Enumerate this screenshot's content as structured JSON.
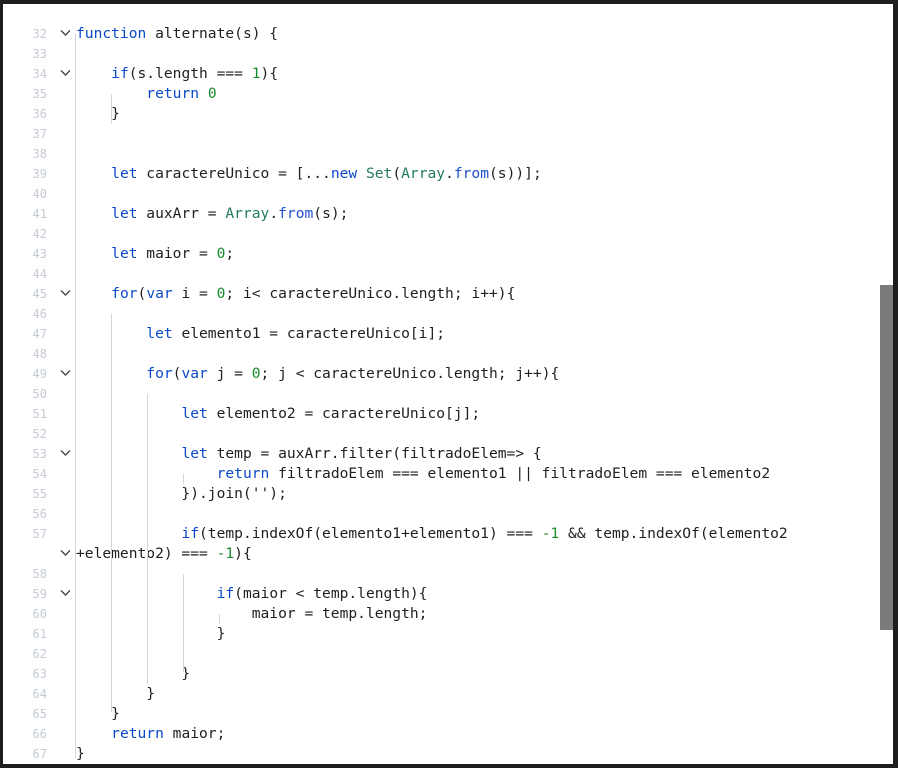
{
  "editor": {
    "language": "javascript",
    "colors": {
      "keyword": "#0b49c9",
      "builtin": "#237a5e",
      "number": "#188a2b",
      "text": "#1f1f1f"
    },
    "lines": [
      {
        "n": "32",
        "fold": true,
        "code": [
          {
            "t": "function",
            "c": "kw"
          },
          {
            "t": " alternate(s) {"
          }
        ]
      },
      {
        "n": "33",
        "fold": false,
        "code": []
      },
      {
        "n": "34",
        "fold": true,
        "code": [
          {
            "t": "    "
          },
          {
            "t": "if",
            "c": "kw"
          },
          {
            "t": "(s.length === "
          },
          {
            "t": "1",
            "c": "num"
          },
          {
            "t": "){"
          }
        ]
      },
      {
        "n": "35",
        "fold": false,
        "code": [
          {
            "t": "        "
          },
          {
            "t": "return",
            "c": "kw"
          },
          {
            "t": " "
          },
          {
            "t": "0",
            "c": "num"
          }
        ]
      },
      {
        "n": "36",
        "fold": false,
        "code": [
          {
            "t": "    }"
          }
        ]
      },
      {
        "n": "37",
        "fold": false,
        "code": []
      },
      {
        "n": "38",
        "fold": false,
        "code": []
      },
      {
        "n": "39",
        "fold": false,
        "code": [
          {
            "t": "    "
          },
          {
            "t": "let",
            "c": "kw"
          },
          {
            "t": " caractereUnico = [..."
          },
          {
            "t": "new",
            "c": "kw"
          },
          {
            "t": " "
          },
          {
            "t": "Set",
            "c": "cls"
          },
          {
            "t": "("
          },
          {
            "t": "Array",
            "c": "cls"
          },
          {
            "t": "."
          },
          {
            "t": "from",
            "c": "fn"
          },
          {
            "t": "(s))];"
          }
        ]
      },
      {
        "n": "40",
        "fold": false,
        "code": []
      },
      {
        "n": "41",
        "fold": false,
        "code": [
          {
            "t": "    "
          },
          {
            "t": "let",
            "c": "kw"
          },
          {
            "t": " auxArr = "
          },
          {
            "t": "Array",
            "c": "cls"
          },
          {
            "t": "."
          },
          {
            "t": "from",
            "c": "fn"
          },
          {
            "t": "(s);"
          }
        ]
      },
      {
        "n": "42",
        "fold": false,
        "code": []
      },
      {
        "n": "43",
        "fold": false,
        "code": [
          {
            "t": "    "
          },
          {
            "t": "let",
            "c": "kw"
          },
          {
            "t": " maior = "
          },
          {
            "t": "0",
            "c": "num"
          },
          {
            "t": ";"
          }
        ]
      },
      {
        "n": "44",
        "fold": false,
        "code": []
      },
      {
        "n": "45",
        "fold": true,
        "code": [
          {
            "t": "    "
          },
          {
            "t": "for",
            "c": "kw"
          },
          {
            "t": "("
          },
          {
            "t": "var",
            "c": "kw"
          },
          {
            "t": " i = "
          },
          {
            "t": "0",
            "c": "num"
          },
          {
            "t": "; i< caractereUnico.length; i++){"
          }
        ]
      },
      {
        "n": "46",
        "fold": false,
        "code": []
      },
      {
        "n": "47",
        "fold": false,
        "code": [
          {
            "t": "        "
          },
          {
            "t": "let",
            "c": "kw"
          },
          {
            "t": " elemento1 = caractereUnico[i];"
          }
        ]
      },
      {
        "n": "48",
        "fold": false,
        "code": []
      },
      {
        "n": "49",
        "fold": true,
        "code": [
          {
            "t": "        "
          },
          {
            "t": "for",
            "c": "kw"
          },
          {
            "t": "("
          },
          {
            "t": "var",
            "c": "kw"
          },
          {
            "t": " j = "
          },
          {
            "t": "0",
            "c": "num"
          },
          {
            "t": "; j < caractereUnico.length; j++){"
          }
        ]
      },
      {
        "n": "50",
        "fold": false,
        "code": []
      },
      {
        "n": "51",
        "fold": false,
        "code": [
          {
            "t": "            "
          },
          {
            "t": "let",
            "c": "kw"
          },
          {
            "t": " elemento2 = caractereUnico[j];"
          }
        ]
      },
      {
        "n": "52",
        "fold": false,
        "code": []
      },
      {
        "n": "53",
        "fold": true,
        "code": [
          {
            "t": "            "
          },
          {
            "t": "let",
            "c": "kw"
          },
          {
            "t": " temp = auxArr.filter(filtradoElem=> {"
          }
        ]
      },
      {
        "n": "54",
        "fold": false,
        "code": [
          {
            "t": "                "
          },
          {
            "t": "return",
            "c": "kw"
          },
          {
            "t": " filtradoElem === elemento1 || filtradoElem === elemento2"
          }
        ]
      },
      {
        "n": "55",
        "fold": false,
        "code": [
          {
            "t": "            }).join('');"
          }
        ]
      },
      {
        "n": "56",
        "fold": false,
        "code": []
      },
      {
        "n": "57",
        "fold": false,
        "code": [
          {
            "t": "            "
          },
          {
            "t": "if",
            "c": "kw"
          },
          {
            "t": "(temp.indexOf(elemento1+elemento1) === "
          },
          {
            "t": "-1",
            "c": "num"
          },
          {
            "t": " && temp.indexOf(elemento2"
          }
        ]
      },
      {
        "n": "",
        "fold": true,
        "code": [
          {
            "t": "+elemento2) === "
          },
          {
            "t": "-1",
            "c": "num"
          },
          {
            "t": "){"
          }
        ]
      },
      {
        "n": "58",
        "fold": false,
        "code": []
      },
      {
        "n": "59",
        "fold": true,
        "code": [
          {
            "t": "                "
          },
          {
            "t": "if",
            "c": "kw"
          },
          {
            "t": "(maior < temp.length){"
          }
        ]
      },
      {
        "n": "60",
        "fold": false,
        "code": [
          {
            "t": "                    maior = temp.length;"
          }
        ]
      },
      {
        "n": "61",
        "fold": false,
        "code": [
          {
            "t": "                }"
          }
        ]
      },
      {
        "n": "62",
        "fold": false,
        "code": []
      },
      {
        "n": "63",
        "fold": false,
        "code": [
          {
            "t": "            }"
          }
        ]
      },
      {
        "n": "64",
        "fold": false,
        "code": [
          {
            "t": "        }"
          }
        ]
      },
      {
        "n": "65",
        "fold": false,
        "code": [
          {
            "t": "    }"
          }
        ]
      },
      {
        "n": "66",
        "fold": false,
        "code": [
          {
            "t": "    "
          },
          {
            "t": "return",
            "c": "kw"
          },
          {
            "t": " maior;"
          }
        ]
      },
      {
        "n": "67",
        "fold": false,
        "code": [
          {
            "t": "}"
          }
        ]
      }
    ]
  }
}
